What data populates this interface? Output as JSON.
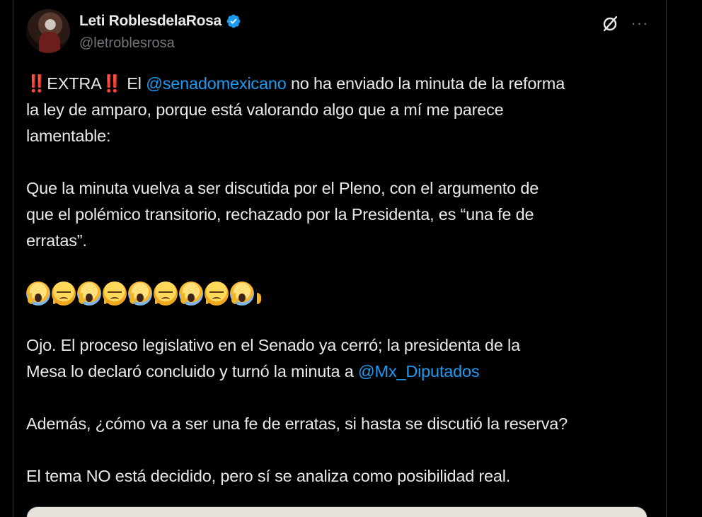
{
  "author": {
    "display_name": "Leti RoblesdelaRosa",
    "handle": "@letroblesrosa",
    "verified": true
  },
  "actions": {
    "grok_icon": "slashed-circle-icon",
    "more_label": "···"
  },
  "tweet": {
    "p1_prefix": "EXTRA",
    "p1_bang": "‼️",
    "p1_mention": "@senadomexicano",
    "p1_rest_a": "no ha enviado la minuta de la reforma",
    "p1_rest_b": "la ley de amparo, porque está valorando algo que a mí me parece",
    "p1_rest_c": "lamentable:",
    "p2_a": "Que la minuta vuelva a ser discutida por el Pleno, con el argumento de",
    "p2_b": "que el polémico transitorio, rechazado por la Presidenta, es “una fe de",
    "p2_c": "erratas”.",
    "emojis": [
      "scream",
      "pensive",
      "scream",
      "pensive",
      "scream",
      "pensive",
      "scream",
      "pensive",
      "scream"
    ],
    "p4_a": "Ojo. El proceso legislativo en el Senado ya cerró; la presidenta de la",
    "p4_b": "Mesa lo declaró concluido y turnó la minuta a",
    "p4_mention": "@Mx_Diputados",
    "p5": "Además, ¿cómo va a ser una fe de erratas, si hasta se discutió la reserva?",
    "p6": "El tema NO está decidido, pero sí se analiza como posibilidad real."
  },
  "colors": {
    "background": "#000000",
    "text": "#e7e9ea",
    "secondary": "#71767b",
    "link": "#1d9bf0",
    "verified": "#1d9bf0",
    "bang": "#e0245e"
  }
}
